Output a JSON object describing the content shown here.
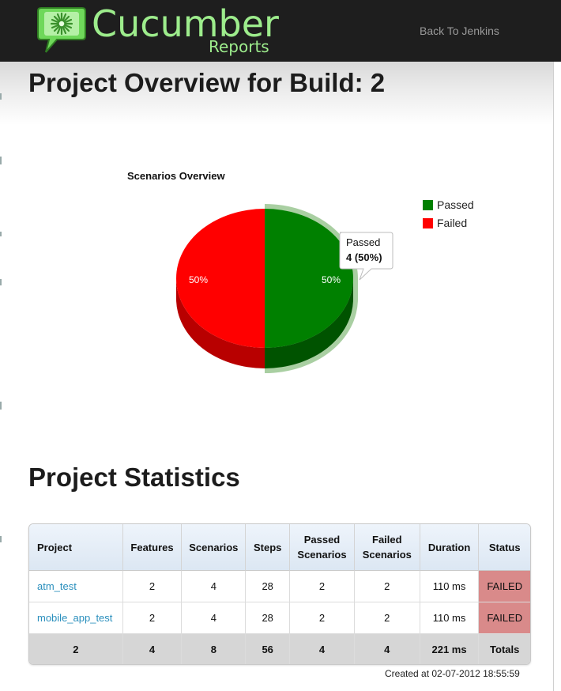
{
  "header": {
    "logo_title": "Cucumber",
    "logo_subtitle": "Reports",
    "back_link": "Back To Jenkins"
  },
  "page_title": "Project Overview for Build: 2",
  "chart_data": {
    "type": "pie",
    "title": "Scenarios Overview",
    "categories": [
      "Passed",
      "Failed"
    ],
    "values": [
      4,
      4
    ],
    "percent_labels": [
      "50%",
      "50%"
    ],
    "colors": [
      "#008000",
      "#ff0000"
    ],
    "legend": "top-right",
    "tooltip": {
      "label": "Passed",
      "value": "4 (50%)"
    }
  },
  "stats": {
    "title": "Project Statistics",
    "columns": [
      "Project",
      "Features",
      "Scenarios",
      "Steps",
      "Passed Scenarios",
      "Failed Scenarios",
      "Duration",
      "Status"
    ],
    "rows": [
      {
        "project": "atm_test",
        "features": "2",
        "scenarios": "4",
        "steps": "28",
        "passed": "2",
        "failed": "2",
        "duration": "110 ms",
        "status": "FAILED"
      },
      {
        "project": "mobile_app_test",
        "features": "2",
        "scenarios": "4",
        "steps": "28",
        "passed": "2",
        "failed": "2",
        "duration": "110 ms",
        "status": "FAILED"
      }
    ],
    "totals": {
      "project": "2",
      "features": "4",
      "scenarios": "8",
      "steps": "56",
      "passed": "4",
      "failed": "4",
      "duration": "221 ms",
      "status": "Totals"
    }
  },
  "footer": {
    "created": "Created at 02-07-2012 18:55:59"
  },
  "colors": {
    "header_bg": "#1e1e1e",
    "logo_green": "#9dec8c",
    "link": "#2a8fbd",
    "failed_cell": "#d98a8a",
    "passed_slice": "#008000",
    "failed_slice": "#ff0000"
  }
}
